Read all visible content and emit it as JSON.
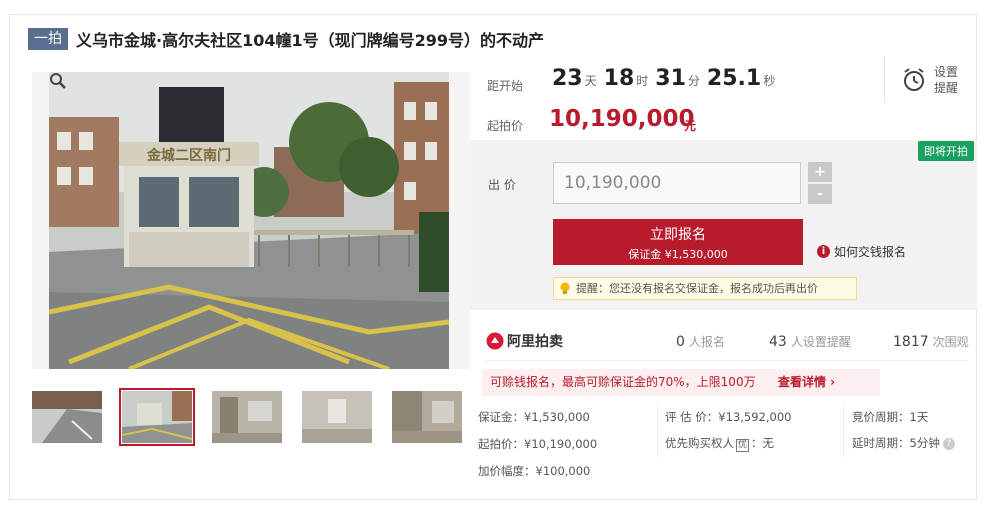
{
  "title": {
    "tag": "一拍",
    "text": "义乌市金城·高尔夫社区104幢1号（现门牌编号299号）的不动产"
  },
  "gallery": {
    "sign_text": "金城二区南门",
    "thumbnails": [
      "road-photo",
      "gate-photo",
      "room-photo-1",
      "room-photo-2",
      "room-photo-3"
    ],
    "active_index": 1
  },
  "countdown": {
    "label": "距开始",
    "days": "23",
    "days_unit": "天",
    "hours": "18",
    "hours_unit": "时",
    "minutes": "31",
    "minutes_unit": "分",
    "seconds": "25.1",
    "seconds_unit": "秒"
  },
  "start_price": {
    "label": "起拍价",
    "value": "10,190,000",
    "unit": "元"
  },
  "remind": {
    "label": "设置提醒"
  },
  "bid": {
    "badge": "即将开拍",
    "label": "出 价",
    "value": "10,190,000",
    "plus": "+",
    "minus": "-",
    "apply_label": "立即报名",
    "deposit_label": "保证金 ¥1,530,000",
    "howto_label": "如何交钱报名",
    "info_glyph": "i",
    "tip": "提醒：您还没有报名交保证金，报名成功后再出价"
  },
  "platform": {
    "name": "阿里拍卖"
  },
  "stats": [
    {
      "value": "0",
      "unit": "人报名"
    },
    {
      "value": "43",
      "unit": "人设置提醒"
    },
    {
      "value": "1817",
      "unit": "次围观"
    }
  ],
  "promo": {
    "text": "可赊钱报名，最高可赊保证金的70%，上限100万",
    "link": "查看详情 ›"
  },
  "details": {
    "deposit": "保证金：¥1,530,000",
    "start_price": "起拍价：¥10,190,000",
    "increment": "加价幅度：¥100,000",
    "appraisal": "评 估 价：¥13,592,000",
    "priority_prefix": "优先购买权人",
    "priority_badge": "优",
    "priority_value": "：无",
    "bid_cycle": "竞价周期：1天",
    "delay_cycle": "延时周期：5分钟",
    "help_glyph": "?"
  },
  "colors": {
    "accent": "#b81c2c",
    "badge_green": "#19a15f",
    "tag_blue": "#5a6f8f"
  }
}
